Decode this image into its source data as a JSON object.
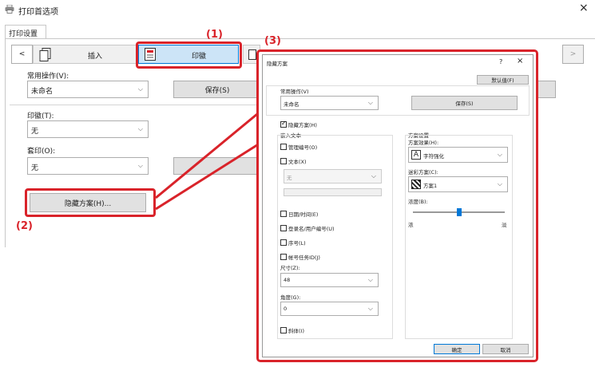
{
  "window": {
    "title": "打印首选项",
    "close": "×"
  },
  "tabs": [
    {
      "label": "打印设置"
    }
  ],
  "toolbar": {
    "left_arrow": "<",
    "right_arrow": ">",
    "insert": "插入",
    "stamp": "印徽"
  },
  "main": {
    "favorite_label": "常用操作(V):",
    "favorite_value": "未命名",
    "save": "保存(S)",
    "stamp_label": "印徽(T):",
    "stamp_value": "无",
    "overlay_label": "套印(O):",
    "overlay_value": "无",
    "hidden_pattern_button": "隐藏方案(H)..."
  },
  "callouts": {
    "c1": "(1)",
    "c2": "(2)",
    "c3": "(3)"
  },
  "dialog": {
    "title": "隐藏方案",
    "help": "?",
    "close": "×",
    "default_btn": "默认值(F)",
    "favorite_label": "常用操作(V)",
    "favorite_value": "未命名",
    "save": "保存(S)",
    "hidden_pattern_check": "隐藏方案(H)",
    "embed_text_group": "嵌入文本",
    "manage_number": "管理编号(O)",
    "text_check": "文本(X)",
    "text_value": "无",
    "datetime": "日期/时间(E)",
    "login_user": "登录名/用户编号(U)",
    "serial": "序号(L)",
    "account_job_id": "帐号任务ID(J)",
    "size_label": "尺寸(Z):",
    "size_value": "48",
    "angle_label": "角度(G):",
    "angle_value": "0",
    "italic": "斜体(I)",
    "pattern_group": "方案设置",
    "pattern_effect_label": "方案效果(H):",
    "pattern_effect_value": "字符强化",
    "pattern_effect_icon_text": "A",
    "camouflage_label": "迷彩方案(C):",
    "camouflage_value": "方案1",
    "density_label": "浓度(B):",
    "density_low": "浓",
    "density_high": "淡",
    "density_level": 0.5,
    "ok": "确定",
    "cancel": "取消"
  },
  "colors": {
    "callout": "#d9232a"
  }
}
